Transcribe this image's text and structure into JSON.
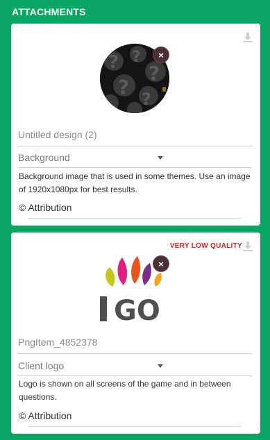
{
  "panel": {
    "title": "ATTACHMENTS"
  },
  "attachments": [
    {
      "name": "Untitled design (2)",
      "type": "Background",
      "description": "Background image that is used in some themes. Use an image of 1920x1080px for best results.",
      "attribution": "© Attribution",
      "remove_symbol": "×",
      "icons": {
        "download": "download-icon",
        "remove": "close-icon"
      }
    },
    {
      "name": "PngItem_4852378",
      "type": "Client logo",
      "quality_warning": "VERY LOW QUALITY",
      "description": "Logo is shown on all screens of the game and in between questions.",
      "attribution": "© Attribution",
      "remove_symbol": "×",
      "logo_text": "GO",
      "icons": {
        "download": "download-icon",
        "remove": "close-icon"
      }
    }
  ],
  "colors": {
    "panel_bg": "#0aa664",
    "warning": "#d81b1b",
    "remove_button": "#4a2f33"
  }
}
